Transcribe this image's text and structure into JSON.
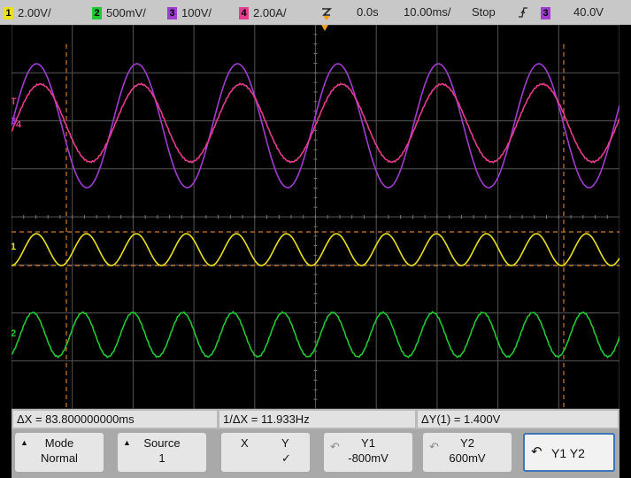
{
  "colors": {
    "ch1": "#e8e020",
    "ch2": "#22c833",
    "ch3": "#a03cd0",
    "ch4": "#e63c8c",
    "cursor": "#d07a2a",
    "trigger": "#f0a020"
  },
  "status_bar": {
    "ch1": {
      "badge": "1",
      "scale": "2.00V/"
    },
    "ch2": {
      "badge": "2",
      "scale": "500mV/"
    },
    "ch3": {
      "badge": "3",
      "scale": "100V/"
    },
    "ch4": {
      "badge": "4",
      "scale": "2.00A/"
    },
    "delay": "0.0s",
    "timebase": "10.00ms/",
    "run_state": "Stop",
    "trigger_slope_icon": "rising-edge-icon",
    "trigger_source_badge": "3",
    "trigger_level": "40.0V"
  },
  "channel_markers": {
    "trigger_marker": "T",
    "ch3": "3",
    "ch4": "4",
    "ch1": "1",
    "ch2": "2"
  },
  "readouts": {
    "delta_x": "ΔX = 83.800000000ms",
    "inv_delta_x": "1/ΔX = 11.933Hz",
    "delta_y": "ΔY(1) = 1.400V"
  },
  "softkeys": {
    "mode": {
      "label": "Mode",
      "value": "Normal"
    },
    "source": {
      "label": "Source",
      "value": "1"
    },
    "xy": {
      "x": "X",
      "y": "Y",
      "check": "✓"
    },
    "y1": {
      "label": "Y1",
      "value": "-800mV"
    },
    "y2": {
      "label": "Y2",
      "value": "600mV"
    },
    "y1y2": {
      "label": "Y1 Y2"
    }
  }
}
